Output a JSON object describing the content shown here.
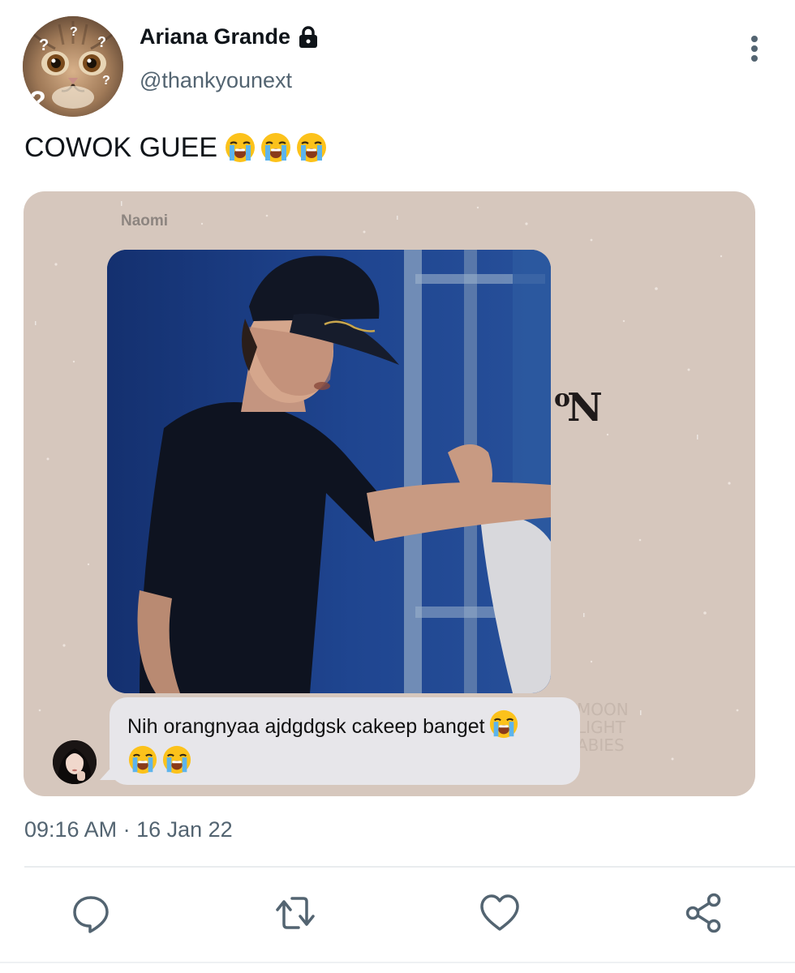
{
  "user": {
    "display_name": "Ariana Grande",
    "handle": "@thankyounext",
    "protected_icon": "lock-icon",
    "avatar": "cat-face-avatar"
  },
  "tweet": {
    "text": "COWOK GUEE",
    "text_emojis": [
      "loudly-crying-face-emoji",
      "loudly-crying-face-emoji",
      "loudly-crying-face-emoji"
    ],
    "timestamp": "09:16 AM · 16 Jan 22"
  },
  "media": {
    "sender_name": "Naomi",
    "message": "Nih orangnyaa ajdgdgsk cakeep banget",
    "message_emojis": [
      "loudly-crying-face-emoji",
      "loudly-crying-face-emoji",
      "loudly-crying-face-emoji"
    ],
    "background_letters": "N",
    "background_superscript": "o",
    "watermark_lines": [
      "MOON",
      "LIGHT",
      "ABIES"
    ],
    "photo": "man-in-black-cap-dancing"
  },
  "actions": [
    {
      "name": "reply",
      "icon": "reply-icon"
    },
    {
      "name": "retweet",
      "icon": "retweet-icon"
    },
    {
      "name": "like",
      "icon": "heart-icon"
    },
    {
      "name": "share",
      "icon": "share-icon"
    }
  ],
  "colors": {
    "text_primary": "#0f1419",
    "text_secondary": "#536471",
    "divider": "#e9ecee",
    "media_background": "#d6c7bd",
    "chat_bubble": "#e7e6ea"
  }
}
